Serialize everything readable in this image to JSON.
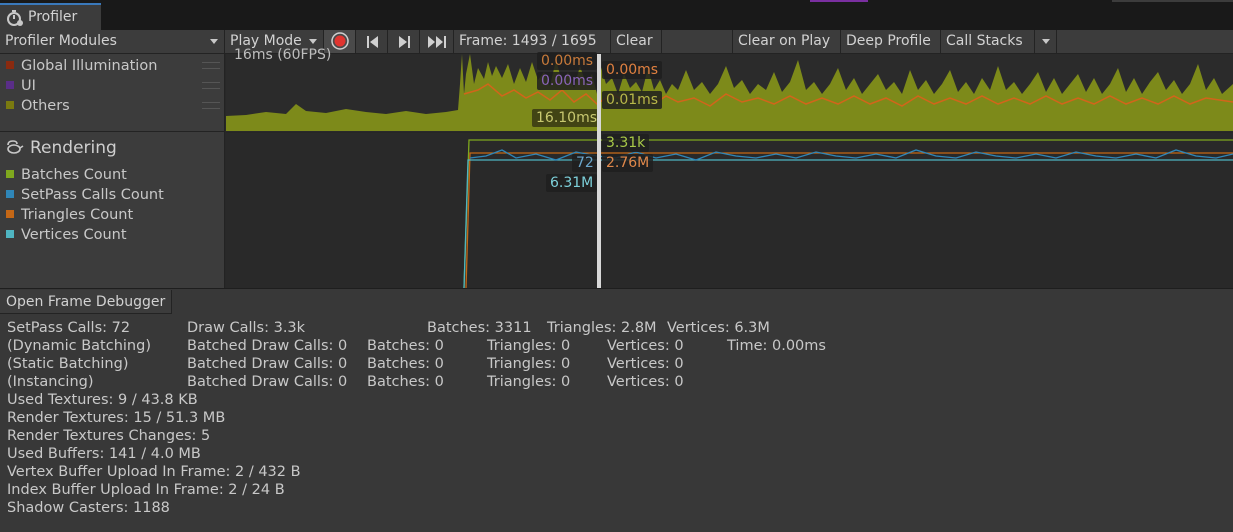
{
  "window": {
    "tab_title": "Profiler"
  },
  "toolbar": {
    "modules_label": "Profiler Modules",
    "mode_label": "Play Mode",
    "frame_label": "Frame: 1493 / 1695",
    "clear_label": "Clear",
    "clear_on_play_label": "Clear on Play",
    "deep_profile_label": "Deep Profile",
    "call_stacks_label": "Call Stacks"
  },
  "cpu_module": {
    "legend": [
      {
        "label": "Global Illumination",
        "color": "#8a2a0f"
      },
      {
        "label": "UI",
        "color": "#5a2e88"
      },
      {
        "label": "Others",
        "color": "#7a7a10"
      }
    ],
    "fps_label": "16ms (60FPS)",
    "tags": {
      "gi_left": "0.00ms",
      "ui_left": "0.00ms",
      "gi_right": "0.00ms",
      "others_right": "0.01ms",
      "total": "16.10ms"
    }
  },
  "rendering_module": {
    "title": "Rendering",
    "legend": [
      {
        "label": "Batches Count",
        "color": "#7fa81e"
      },
      {
        "label": "SetPass Calls Count",
        "color": "#2f86b8"
      },
      {
        "label": "Triangles Count",
        "color": "#c46716"
      },
      {
        "label": "Vertices Count",
        "color": "#4fb5c2"
      }
    ],
    "tags": {
      "batches": "3.31k",
      "setpass": "72",
      "triangles": "2.76M",
      "vertices": "6.31M"
    }
  },
  "details": {
    "open_frame_debugger_label": "Open Frame Debugger",
    "row1": {
      "setpass": "SetPass Calls: 72",
      "draw_calls": "Draw Calls: 3.3k",
      "batches": "Batches: 3311",
      "triangles": "Triangles: 2.8M",
      "vertices": "Vertices: 6.3M"
    },
    "batch_rows": [
      {
        "label": "(Dynamic Batching)",
        "draw": "Batched Draw Calls: 0",
        "batches": "Batches: 0",
        "tris": "Triangles: 0",
        "verts": "Vertices: 0",
        "time": "Time: 0.00ms"
      },
      {
        "label": "(Static Batching)",
        "draw": "Batched Draw Calls: 0",
        "batches": "Batches: 0",
        "tris": "Triangles: 0",
        "verts": "Vertices: 0",
        "time": ""
      },
      {
        "label": "(Instancing)",
        "draw": "Batched Draw Calls: 0",
        "batches": "Batches: 0",
        "tris": "Triangles: 0",
        "verts": "Vertices: 0",
        "time": ""
      }
    ],
    "stats": [
      "Used Textures: 9 / 43.8 KB",
      "Render Textures: 15 / 51.3 MB",
      "Render Textures Changes: 5",
      "Used Buffers: 141 / 4.0 MB",
      "Vertex Buffer Upload In Frame: 2 / 432 B",
      "Index Buffer Upload In Frame: 2 / 24 B",
      "Shadow Casters: 1188"
    ]
  }
}
